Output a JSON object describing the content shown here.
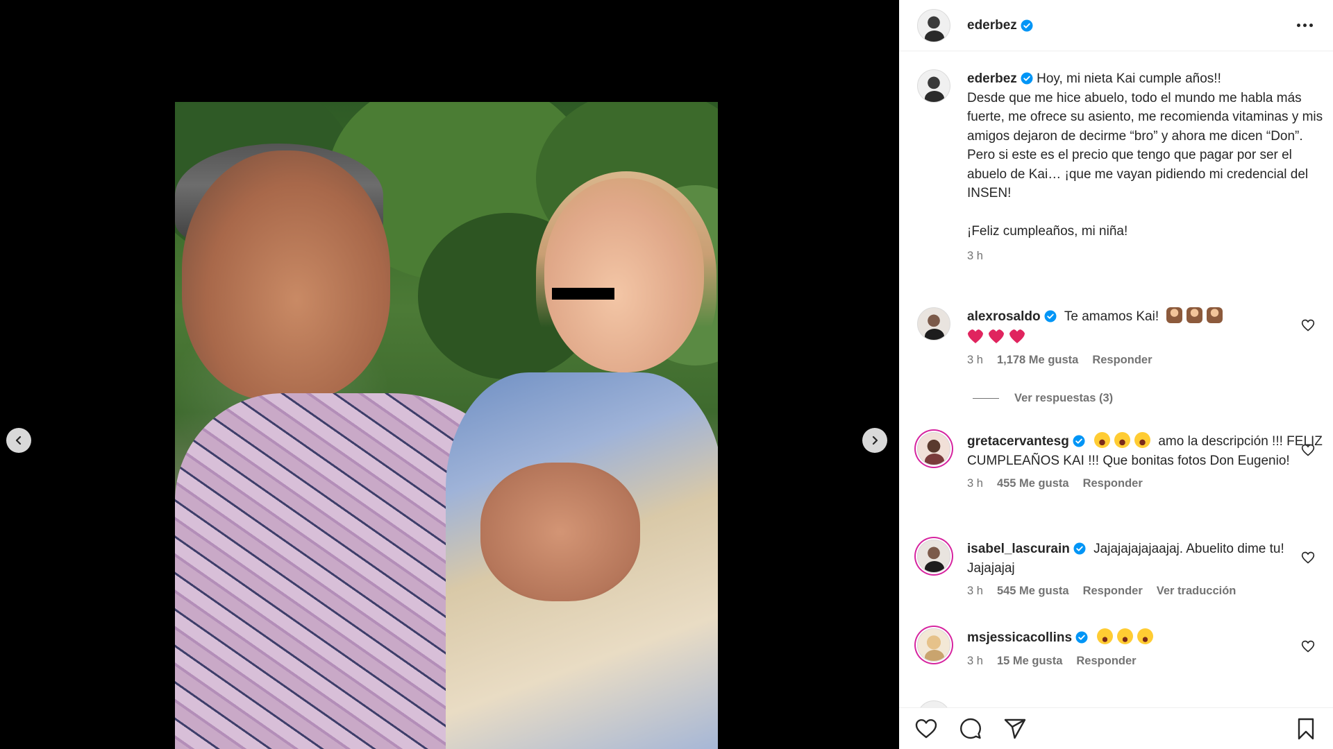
{
  "post": {
    "author": "ederbez",
    "caption_username": "ederbez",
    "caption": "Hoy, mi nieta Kai cumple años!!\nDesde que me hice abuelo, todo el mundo me habla más fuerte, me ofrece su asiento, me recomienda vitaminas y mis amigos dejaron de decirme “bro” y ahora me dicen “Don”.\nPero si este es el precio que tengo que pagar por ser el abuelo de Kai… ¡que me vayan pidiendo mi credencial del INSEN!\n\n¡Feliz cumpleaños, mi niña!",
    "caption_time": "3 h"
  },
  "comments": [
    {
      "username": "alexrosaldo",
      "text": "Te amamos Kai!",
      "emoji_names": [
        "cake",
        "cake",
        "cake",
        "red-heart",
        "red-heart",
        "red-heart"
      ],
      "time": "3 h",
      "likes": "1,178 Me gusta",
      "reply": "Responder",
      "view_replies": "Ver respuestas (3)"
    },
    {
      "username": "gretacervantesg",
      "emoji_names": [
        "laughing-face",
        "laughing-face",
        "laughing-face"
      ],
      "text": "amo la descripción !!! FELIZ CUMPLEAÑOS KAI !!! Que bonitas fotos Don Eugenio!",
      "time": "3 h",
      "likes": "455 Me gusta",
      "reply": "Responder"
    },
    {
      "username": "isabel_lascurain",
      "text": "Jajajajajajaajaj. Abuelito dime tu! Jajajajaj",
      "time": "3 h",
      "likes": "545 Me gusta",
      "reply": "Responder",
      "translate": "Ver traducción"
    },
    {
      "username": "msjessicacollins",
      "emoji_names": [
        "star-struck-face",
        "star-struck-face",
        "star-struck-face"
      ],
      "time": "3 h",
      "likes": "15 Me gusta",
      "reply": "Responder"
    }
  ],
  "colors": {
    "verified_blue": "#0095f6",
    "text_primary": "#262626",
    "text_secondary": "#737373",
    "story_ring": "#d6249f"
  },
  "icons": {
    "prev": "chevron-left-icon",
    "next": "chevron-right-icon",
    "like": "heart-outline-icon",
    "comment": "comment-bubble-icon",
    "share": "paper-plane-icon",
    "save": "bookmark-icon",
    "more": "more-horizontal-icon"
  }
}
